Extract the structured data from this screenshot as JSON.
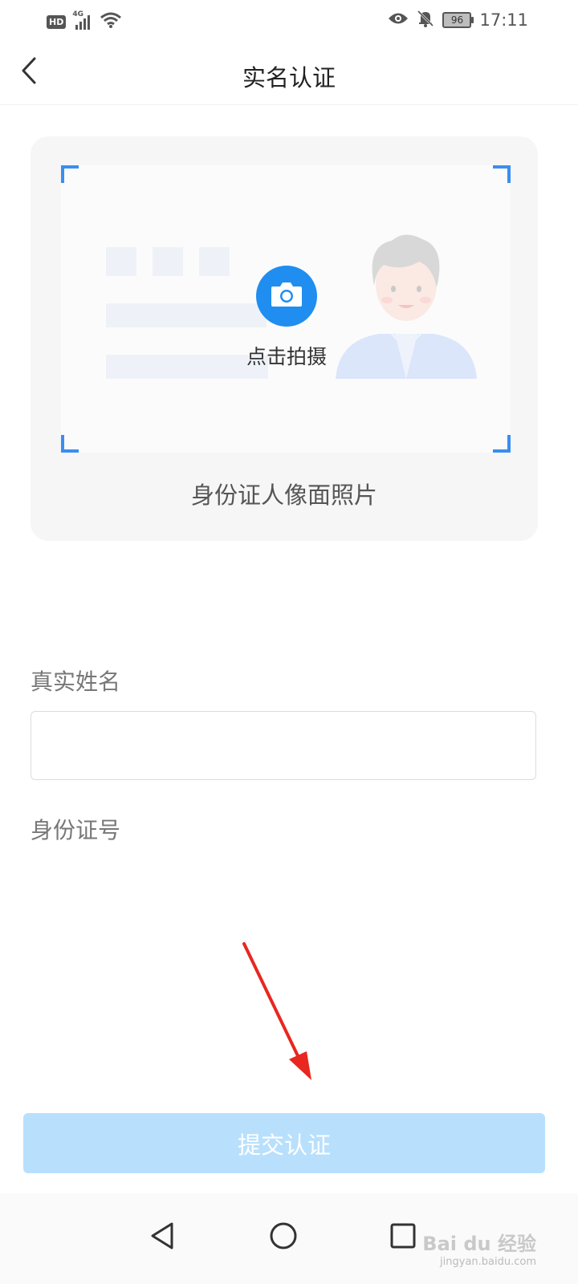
{
  "status_bar": {
    "hd_badge": "HD",
    "network_type": "4G",
    "battery_level": "96",
    "time": "17:11"
  },
  "header": {
    "title": "实名认证"
  },
  "id_card": {
    "capture_label": "点击拍摄",
    "caption": "身份证人像面照片"
  },
  "form": {
    "real_name_label": "真实姓名",
    "real_name_value": "",
    "id_number_label": "身份证号",
    "id_number_value": ""
  },
  "submit": {
    "label": "提交认证"
  },
  "watermark": {
    "brand": "Bai du 经验",
    "url": "jingyan.baidu.com"
  },
  "colors": {
    "accent": "#1f8ef0",
    "submit_disabled": "#b8e0fc",
    "annotation_arrow": "#e8271f"
  }
}
